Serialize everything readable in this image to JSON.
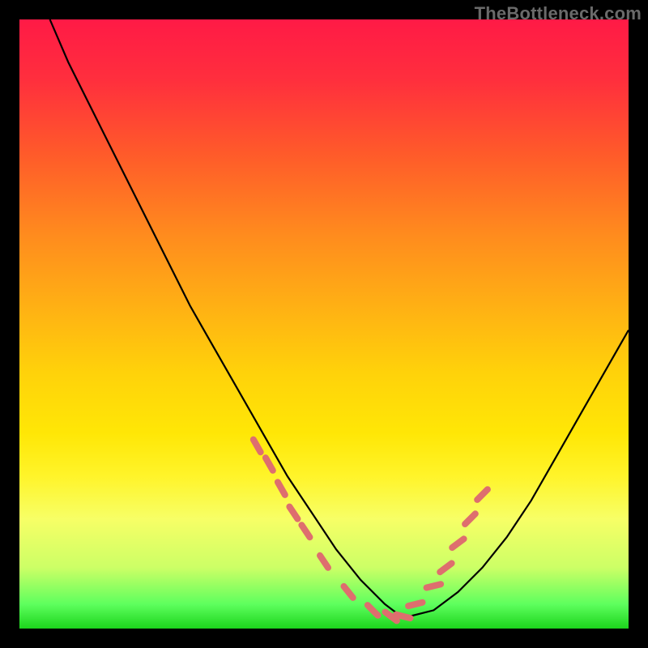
{
  "watermark": "TheBottleneck.com",
  "colors": {
    "background": "#000000",
    "curve": "#000000",
    "marker": "#de6e6e",
    "gradient_top": "#ff1a46",
    "gradient_bottom": "#1cd41c"
  },
  "chart_data": {
    "type": "line",
    "title": "",
    "xlabel": "",
    "ylabel": "",
    "xlim": [
      0,
      100
    ],
    "ylim": [
      0,
      100
    ],
    "grid": false,
    "legend": false,
    "note": "Bottleneck-style valley curve. x is relative horizontal position (0=left), y is relative height (0=bottom, 100=top). Values estimated from pixels.",
    "series": [
      {
        "name": "curve",
        "x": [
          5,
          8,
          12,
          16,
          20,
          24,
          28,
          32,
          36,
          40,
          44,
          48,
          52,
          56,
          60,
          62,
          64,
          68,
          72,
          76,
          80,
          84,
          88,
          92,
          96,
          100
        ],
        "y": [
          100,
          93,
          85,
          77,
          69,
          61,
          53,
          46,
          39,
          32,
          25,
          19,
          13,
          8,
          4,
          2.5,
          2,
          3,
          6,
          10,
          15,
          21,
          28,
          35,
          42,
          49
        ]
      }
    ],
    "markers": {
      "name": "highlighted-points",
      "note": "Short salmon dash segments near the valley and on both rising slopes.",
      "x": [
        39,
        41,
        43,
        45,
        47,
        50,
        54,
        58,
        61,
        63,
        65,
        68,
        70,
        72,
        74,
        76
      ],
      "y": [
        30,
        27,
        23,
        19,
        16,
        11,
        6,
        3,
        2,
        2,
        4,
        7,
        10,
        14,
        18,
        22
      ]
    }
  }
}
